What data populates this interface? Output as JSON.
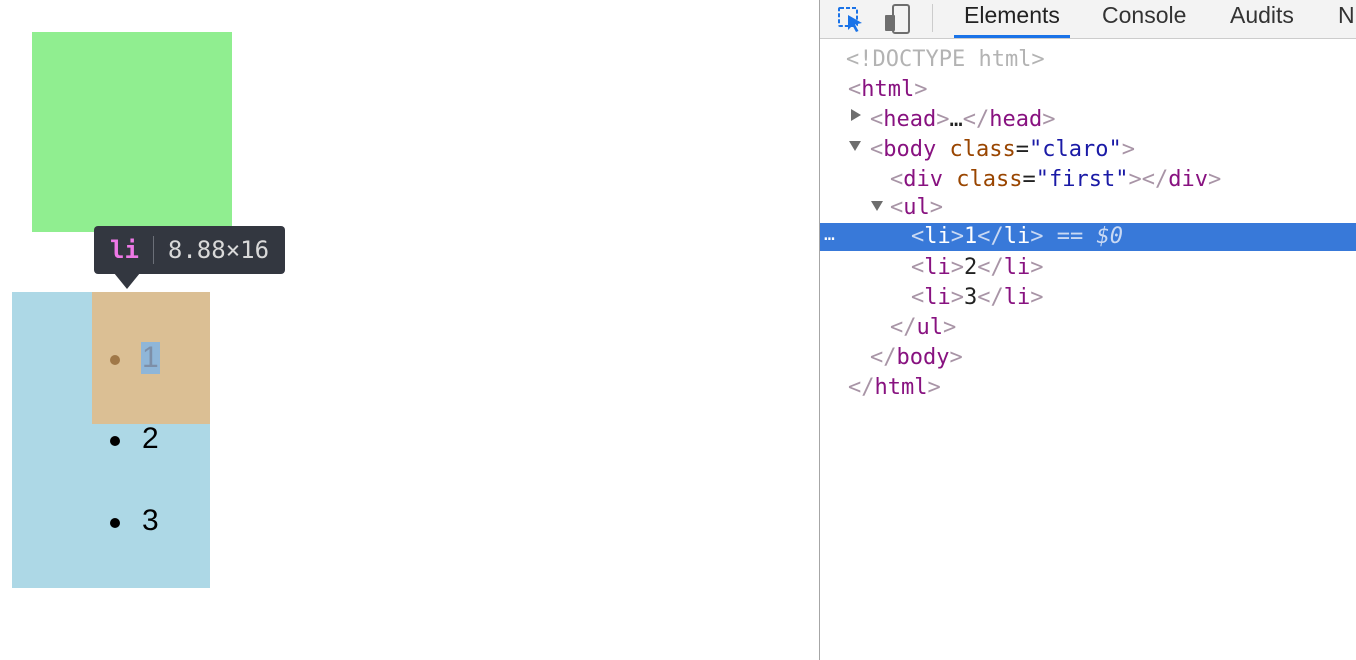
{
  "page": {
    "list_items": [
      "1",
      "2",
      "3"
    ]
  },
  "tooltip": {
    "tag": "li",
    "size": "8.88×16"
  },
  "devtools": {
    "tabs": [
      "Elements",
      "Console",
      "Audits",
      "N"
    ],
    "active_tab": "Elements",
    "dom": {
      "doctype": "<!DOCTYPE html>",
      "html_open": "html",
      "head_tag": "head",
      "head_ellipsis": "…",
      "body_tag": "body",
      "class_attr": "class",
      "body_class_val": "\"claro\"",
      "div_tag": "div",
      "div_class_val": "\"first\"",
      "ul_tag": "ul",
      "li_tag": "li",
      "li_texts": [
        "1",
        "2",
        "3"
      ],
      "selected_marker": "== $0",
      "ellipsis_button": "…"
    },
    "colors": {
      "selection": "#3879d9",
      "tab_underline": "#1a73e8",
      "tag": "#881280",
      "attr_name": "#994500",
      "attr_value": "#1a1aa6"
    }
  },
  "colors": {
    "green_box": "#90ee90",
    "list_bg": "#add8e6",
    "li_highlight": "#dbbf94",
    "tooltip_bg": "#333740"
  }
}
